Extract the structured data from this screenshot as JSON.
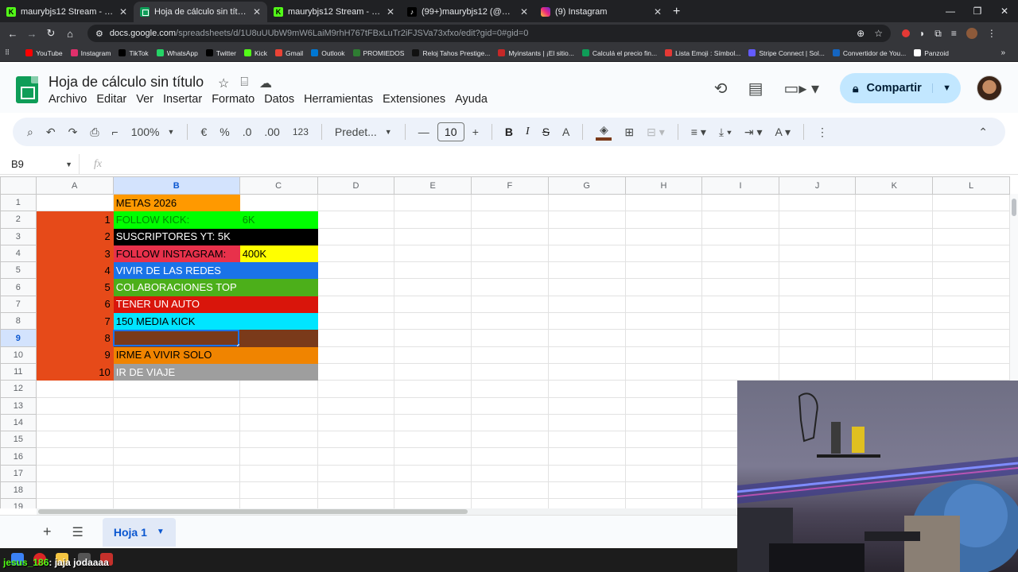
{
  "browser": {
    "tabs": [
      {
        "label": "maurybjs12 Stream - Watch Liv",
        "icon": "kick",
        "active": false
      },
      {
        "label": "Hoja de cálculo sin título - Hoja",
        "icon": "sheets",
        "active": true
      },
      {
        "label": "maurybjs12 Stream - Watch Liv",
        "icon": "kick",
        "active": false
      },
      {
        "label": "(99+)maurybjs12 (@maurybjs1",
        "icon": "tiktok",
        "active": false
      },
      {
        "label": "(9) Instagram",
        "icon": "instagram",
        "active": false
      }
    ],
    "url_host": "docs.google.com",
    "url_path": "/spreadsheets/d/1U8uUUbW9mW6LaiM9rhH767tFBxLuTr2iFJSVa73xfxo/edit?gid=0#gid=0",
    "bookmarks": [
      {
        "label": "YouTube",
        "color": "#ff0000"
      },
      {
        "label": "Instagram",
        "color": "#e1306c"
      },
      {
        "label": "TikTok",
        "color": "#000000"
      },
      {
        "label": "WhatsApp",
        "color": "#25d366"
      },
      {
        "label": "Twitter",
        "color": "#000000"
      },
      {
        "label": "Kick",
        "color": "#53fc18"
      },
      {
        "label": "Gmail",
        "color": "#ea4335"
      },
      {
        "label": "Outlook",
        "color": "#0078d4"
      },
      {
        "label": "PROMIEDOS",
        "color": "#2e7d32"
      },
      {
        "label": "Reloj Tahos Prestige...",
        "color": "#111111"
      },
      {
        "label": "Myinstants | ¡El sitio...",
        "color": "#c62828"
      },
      {
        "label": "Calculá el precio fin...",
        "color": "#0f9d58"
      },
      {
        "label": "Lista Emoji : Símbol...",
        "color": "#e53935"
      },
      {
        "label": "Stripe Connect | Sol...",
        "color": "#635bff"
      },
      {
        "label": "Convertidor de You...",
        "color": "#1565c0"
      },
      {
        "label": "Panzoid",
        "color": "#ffffff"
      }
    ]
  },
  "sheets": {
    "title": "Hoja de cálculo sin título",
    "menus": [
      "Archivo",
      "Editar",
      "Ver",
      "Insertar",
      "Formato",
      "Datos",
      "Herramientas",
      "Extensiones",
      "Ayuda"
    ],
    "share_label": "Compartir",
    "toolbar": {
      "zoom": "100%",
      "currency": "€",
      "percent": "%",
      "dec_decrease": ".0",
      "dec_increase": ".00",
      "number_format": "123",
      "font": "Predet...",
      "font_size": "10",
      "fill_color": "#7a3a1a"
    },
    "name_box": "B9",
    "formula": "",
    "sheet_tab": "Hoja 1"
  },
  "grid": {
    "columns": [
      "A",
      "B",
      "C",
      "D",
      "E",
      "F",
      "G",
      "H",
      "I",
      "J",
      "K",
      "L"
    ],
    "selected_column": "B",
    "selected_row": 9,
    "rows": [
      {
        "num": "1",
        "a": "",
        "a_bg": "",
        "b": "METAS 2026",
        "b_bg": "#ff9900",
        "c": "",
        "c_bg": "",
        "fg": "#000000"
      },
      {
        "num": "2",
        "a": "1",
        "a_bg": "#e64a19",
        "b": "FOLLOW KICK:",
        "b_bg": "#00ff00",
        "c": "6K",
        "c_bg": "#00ff00",
        "fg": "#008a00"
      },
      {
        "num": "3",
        "a": "2",
        "a_bg": "#e64a19",
        "b": "SUSCRIPTORES YT: 5K",
        "b_bg": "#000000",
        "c": "",
        "c_bg": "#000000",
        "fg": "#ffffff"
      },
      {
        "num": "4",
        "a": "3",
        "a_bg": "#e64a19",
        "b": "FOLLOW INSTAGRAM:",
        "b_bg": "#e8314b",
        "c": "400K",
        "c_bg": "#ffff00",
        "fg": "#000000"
      },
      {
        "num": "5",
        "a": "4",
        "a_bg": "#e64a19",
        "b": "VIVIR DE LAS REDES",
        "b_bg": "#1a73e8",
        "c": "",
        "c_bg": "#1a73e8",
        "fg": "#ffffff"
      },
      {
        "num": "6",
        "a": "5",
        "a_bg": "#e64a19",
        "b": "COLABORACIONES TOP",
        "b_bg": "#4caf1a",
        "c": "",
        "c_bg": "#4caf1a",
        "fg": "#ffffff"
      },
      {
        "num": "7",
        "a": "6",
        "a_bg": "#e64a19",
        "b": "TENER UN AUTO",
        "b_bg": "#d9150b",
        "c": "",
        "c_bg": "#d9150b",
        "fg": "#ffffff"
      },
      {
        "num": "8",
        "a": "7",
        "a_bg": "#e64a19",
        "b": "150 MEDIA KICK",
        "b_bg": "#00e5ff",
        "c": "",
        "c_bg": "#00e5ff",
        "fg": "#000000"
      },
      {
        "num": "9",
        "a": "8",
        "a_bg": "#e64a19",
        "b": "",
        "b_bg": "#7a3a1a",
        "c": "",
        "c_bg": "#7a3a1a",
        "fg": "#ffffff"
      },
      {
        "num": "10",
        "a": "9",
        "a_bg": "#e64a19",
        "b": "IRME A VIVIR SOLO",
        "b_bg": "#f08400",
        "c": "",
        "c_bg": "#f08400",
        "fg": "#000000"
      },
      {
        "num": "11",
        "a": "10",
        "a_bg": "#e64a19",
        "b": "IR DE VIAJE",
        "b_bg": "#9e9e9e",
        "c": "",
        "c_bg": "#9e9e9e",
        "fg": "#ffffff"
      },
      {
        "num": "12",
        "a": "",
        "a_bg": "",
        "b": "",
        "b_bg": "",
        "c": "",
        "c_bg": "",
        "fg": "#000000"
      },
      {
        "num": "13",
        "a": "",
        "a_bg": "",
        "b": "",
        "b_bg": "",
        "c": "",
        "c_bg": "",
        "fg": "#000000"
      },
      {
        "num": "14",
        "a": "",
        "a_bg": "",
        "b": "",
        "b_bg": "",
        "c": "",
        "c_bg": "",
        "fg": "#000000"
      },
      {
        "num": "15",
        "a": "",
        "a_bg": "",
        "b": "",
        "b_bg": "",
        "c": "",
        "c_bg": "",
        "fg": "#000000"
      },
      {
        "num": "16",
        "a": "",
        "a_bg": "",
        "b": "",
        "b_bg": "",
        "c": "",
        "c_bg": "",
        "fg": "#000000"
      },
      {
        "num": "17",
        "a": "",
        "a_bg": "",
        "b": "",
        "b_bg": "",
        "c": "",
        "c_bg": "",
        "fg": "#000000"
      },
      {
        "num": "18",
        "a": "",
        "a_bg": "",
        "b": "",
        "b_bg": "",
        "c": "",
        "c_bg": "",
        "fg": "#000000"
      },
      {
        "num": "19",
        "a": "",
        "a_bg": "",
        "b": "",
        "b_bg": "",
        "c": "",
        "c_bg": "",
        "fg": "#000000"
      }
    ]
  },
  "stream": {
    "chat_user": "jesus_186",
    "chat_message": ": jaja jodaaaa"
  }
}
